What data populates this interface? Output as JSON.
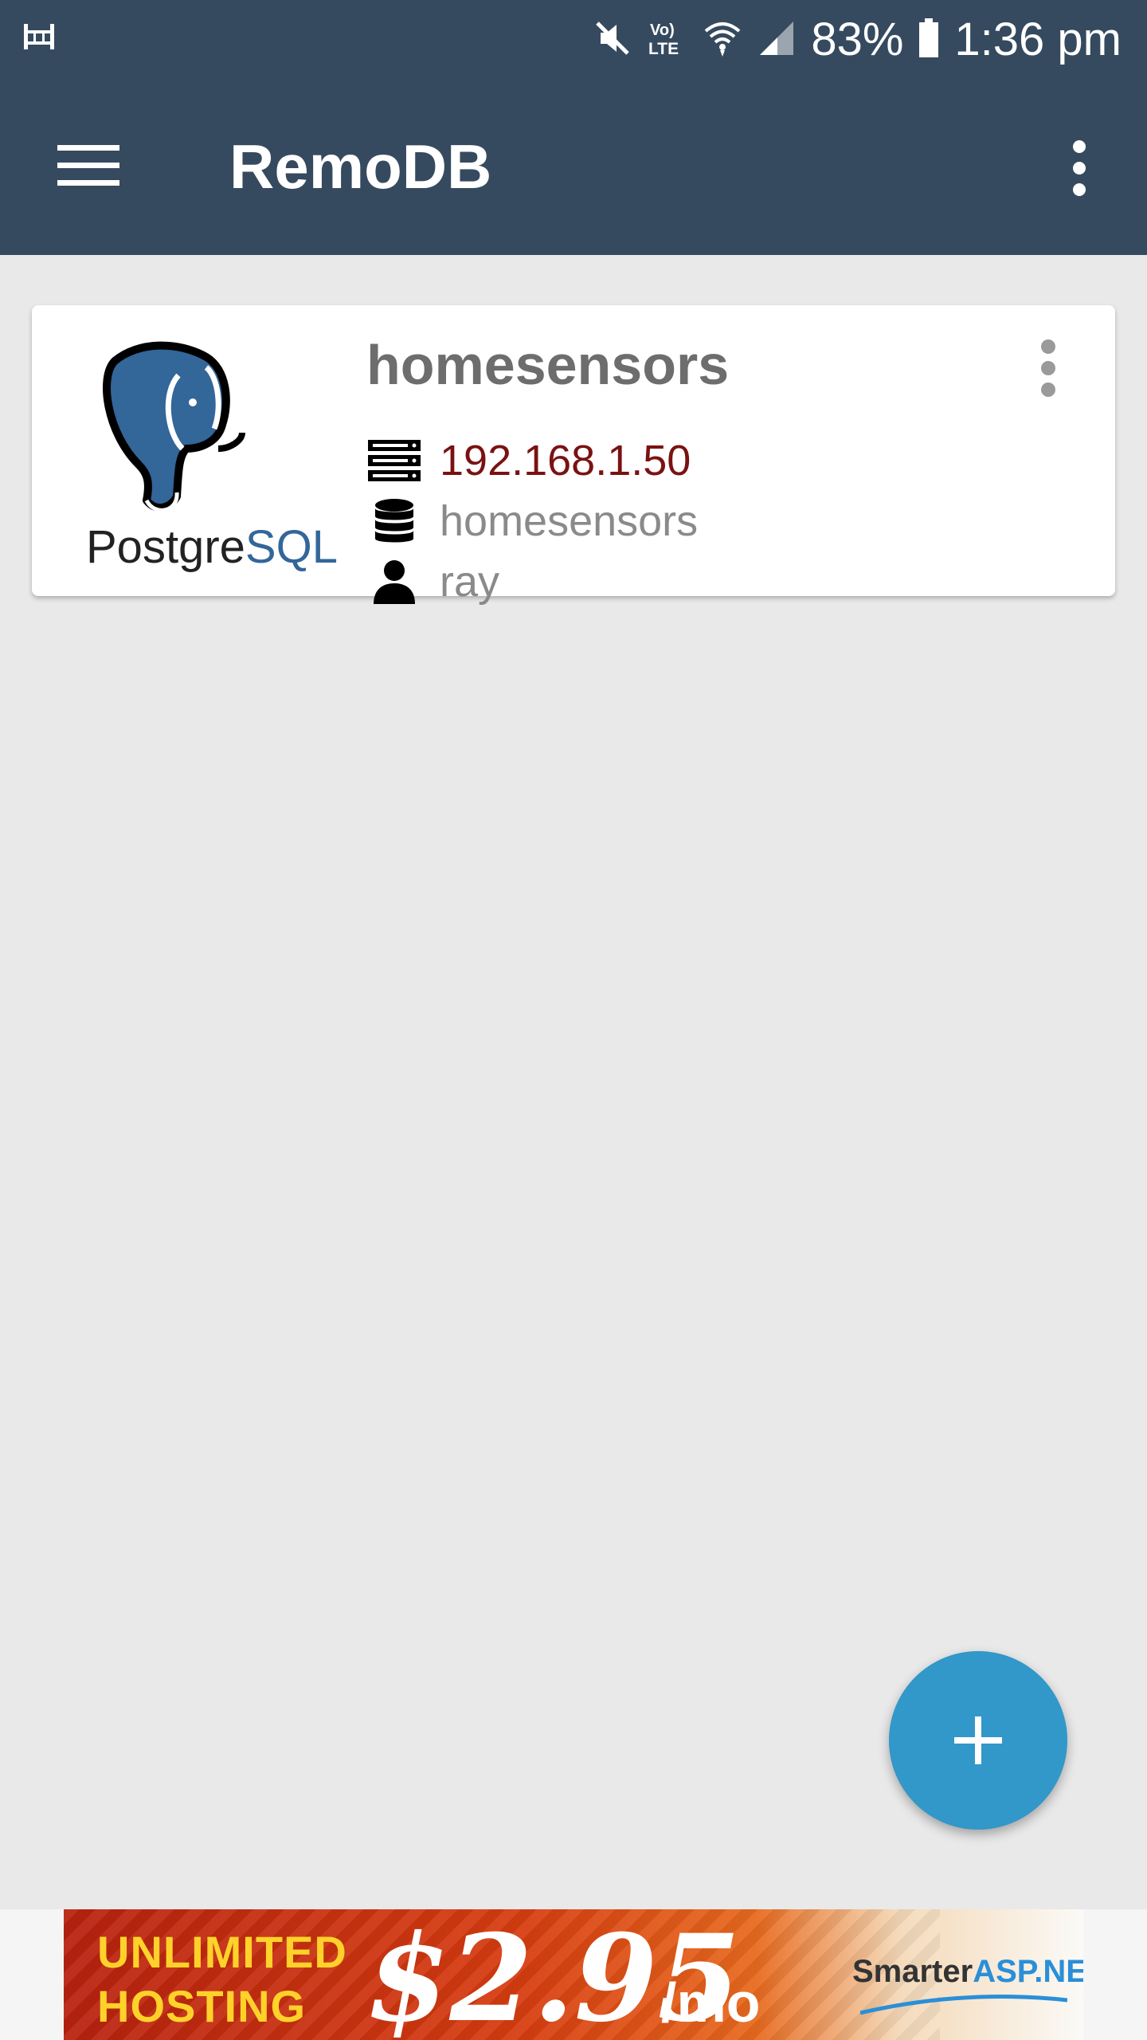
{
  "status_bar": {
    "battery_percent": "83%",
    "time": "1:36 pm",
    "network_label": "Vo) LTE",
    "icons": [
      "notification-icon",
      "mute-icon",
      "volte-icon",
      "wifi-icon",
      "signal-icon",
      "battery-icon"
    ]
  },
  "app_bar": {
    "title": "RemoDB",
    "icons": [
      "menu-icon",
      "more-vert-icon"
    ]
  },
  "connections": [
    {
      "name": "homesensors",
      "type_logo_text_1": "Postgre",
      "type_logo_text_2": "SQL",
      "host": "192.168.1.50",
      "database": "homesensors",
      "user": "ray",
      "icons": [
        "server-icon",
        "database-icon",
        "user-icon",
        "more-vert-icon"
      ]
    }
  ],
  "fab": {
    "icon": "plus-icon"
  },
  "ad": {
    "line1": "UNLIMITED",
    "line2": "HOSTING",
    "price": "$2.95",
    "per": "/mo",
    "brand_1": "Smarter",
    "brand_2": "ASP.NET"
  },
  "colors": {
    "app_bar": "#364a5f",
    "background": "#e9e9e9",
    "host_text": "#7a1212",
    "fab": "#3297c9",
    "postgres_blue": "#336699"
  }
}
